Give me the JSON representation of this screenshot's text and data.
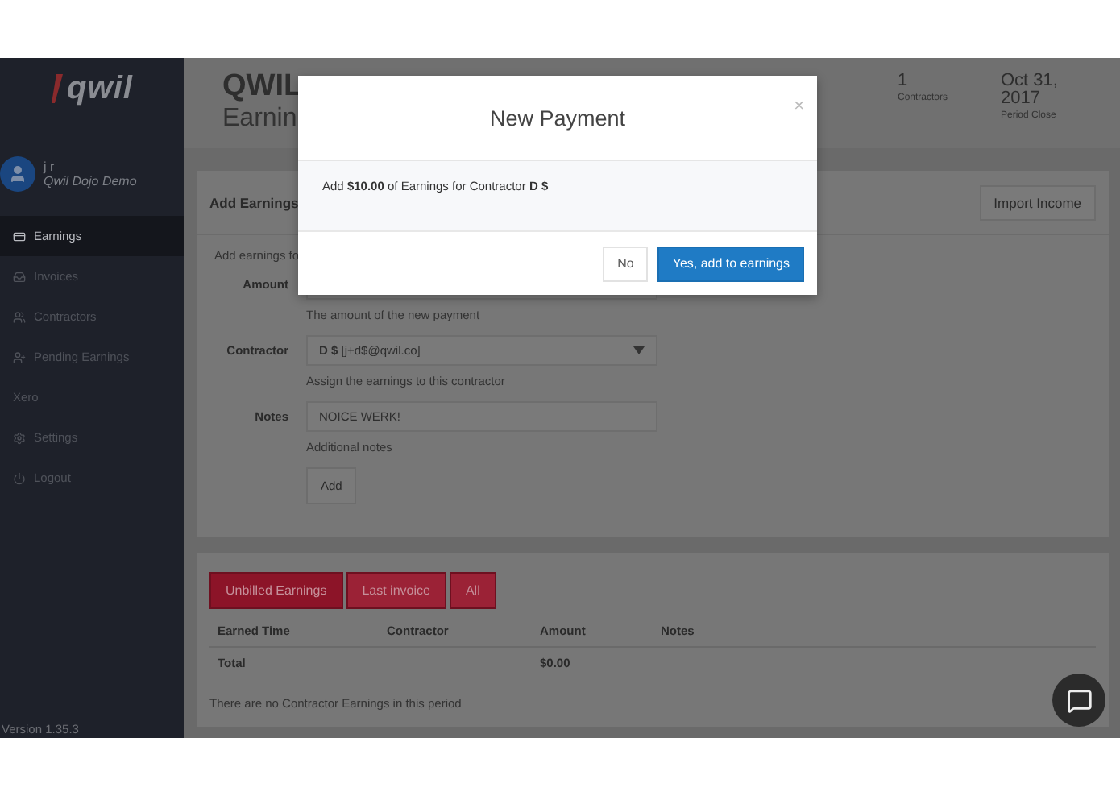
{
  "sidebar": {
    "logo": "qwil",
    "user": {
      "name": "j r",
      "org": "Qwil Dojo Demo"
    },
    "items": [
      {
        "label": "Earnings",
        "selected": true
      },
      {
        "label": "Invoices",
        "selected": false
      },
      {
        "label": "Contractors",
        "selected": false
      },
      {
        "label": "Pending Earnings",
        "selected": false
      },
      {
        "label": "Xero",
        "selected": false
      },
      {
        "label": "Settings",
        "selected": false
      },
      {
        "label": "Logout",
        "selected": false
      }
    ],
    "version": "Version 1.35.3"
  },
  "header": {
    "title": "QWIL",
    "subtitle": "Earnin",
    "stats": [
      {
        "value": "1",
        "label": "Contractors"
      },
      {
        "value": "Oct 31, 2017",
        "label": "Period Close"
      }
    ]
  },
  "add_earnings": {
    "title": "Add Earnings",
    "import_button": "Import Income",
    "intro": "Add earnings fo",
    "fields": [
      {
        "label": "Amount",
        "kind": "input",
        "help": "The amount of the new payment"
      },
      {
        "label": "Contractor",
        "kind": "select",
        "value": "**D $** [j+d$@qwil.co]",
        "help": "Assign the earnings to this contractor"
      },
      {
        "label": "Notes",
        "kind": "input",
        "value": "NOICE WERK!",
        "help": "Additional notes"
      }
    ],
    "submit": "Add"
  },
  "earnings": {
    "tabs": [
      {
        "label": "Unbilled Earnings",
        "selected": true
      },
      {
        "label": "Last invoice",
        "selected": false
      },
      {
        "label": "All",
        "selected": false
      }
    ],
    "columns": [
      "Earned Time",
      "Contractor",
      "Amount",
      "Notes"
    ],
    "total": {
      "label": "Total",
      "amount": "$0.00"
    },
    "empty": "There are no Contractor Earnings in this period"
  },
  "modal": {
    "title": "New Payment",
    "close": "×",
    "message": "Add **$10.00** of Earnings for Contractor **D $**",
    "buttons": [
      {
        "label": "No",
        "kind": "secondary"
      },
      {
        "label": "Yes, add to earnings",
        "kind": "primary"
      }
    ]
  }
}
